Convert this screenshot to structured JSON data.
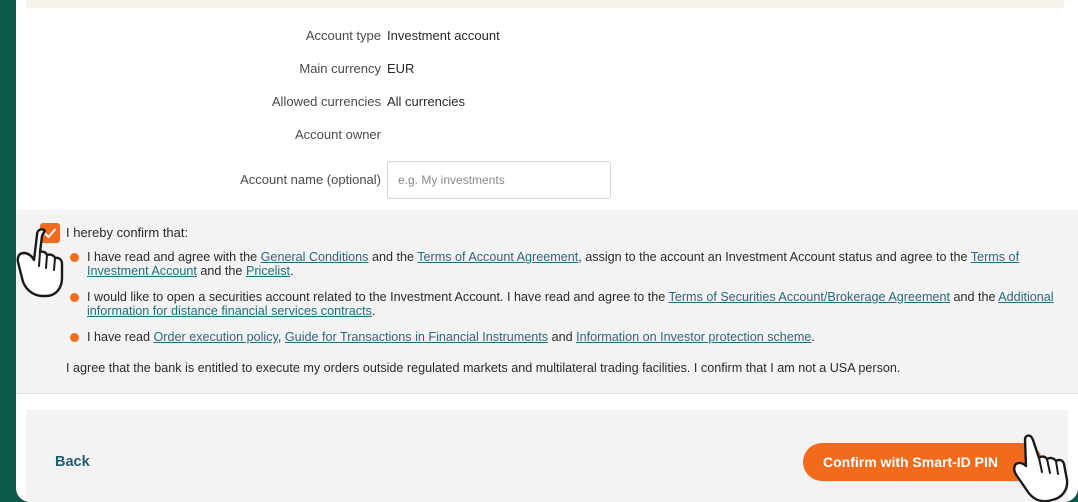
{
  "account": {
    "type_label": "Account type",
    "type_value": "Investment account",
    "currency_label": "Main currency",
    "currency_value": "EUR",
    "allowed_label": "Allowed currencies",
    "allowed_value": "All currencies",
    "owner_label": "Account owner",
    "name_label": "Account name (optional)",
    "name_placeholder": "e.g. My investments"
  },
  "confirm": {
    "checked": true,
    "title": "I hereby confirm that:",
    "b1_t1": "I have read and agree with the ",
    "b1_l1": "General Conditions",
    "b1_t2": " and the ",
    "b1_l2": "Terms of Account Agreement",
    "b1_t3": ", assign to the account an Investment Account status and agree to the ",
    "b1_l3": "Terms of Investment Account",
    "b1_t4": " and the ",
    "b1_l4": "Pricelist",
    "b1_t5": ".",
    "b2_t1": "I would like to open a securities account related to the Investment Account. I have read and agree to the ",
    "b2_l1": "Terms of Securities Account/Brokerage Agreement",
    "b2_t2": " and the ",
    "b2_l2": "Additional information for distance financial services contracts",
    "b2_t3": ".",
    "b3_t1": "I have read ",
    "b3_l1": "Order execution policy",
    "b3_t2": ", ",
    "b3_l2": "Guide for Transactions in Financial Instruments",
    "b3_t3": " and ",
    "b3_l3": "Information on Investor protection scheme",
    "b3_t4": ".",
    "agree_text": "I agree that the bank is entitled to execute my orders outside regulated markets and multilateral trading facilities. I confirm that I am not a USA person."
  },
  "footer": {
    "back_label": "Back",
    "confirm_label": "Confirm with Smart-ID PIN"
  },
  "colors": {
    "background": "#0b5a4a",
    "accent": "#f26b1d",
    "link": "#1f6e7a"
  },
  "icons": [
    "checkmark-icon",
    "hand-pointer-icon"
  ]
}
